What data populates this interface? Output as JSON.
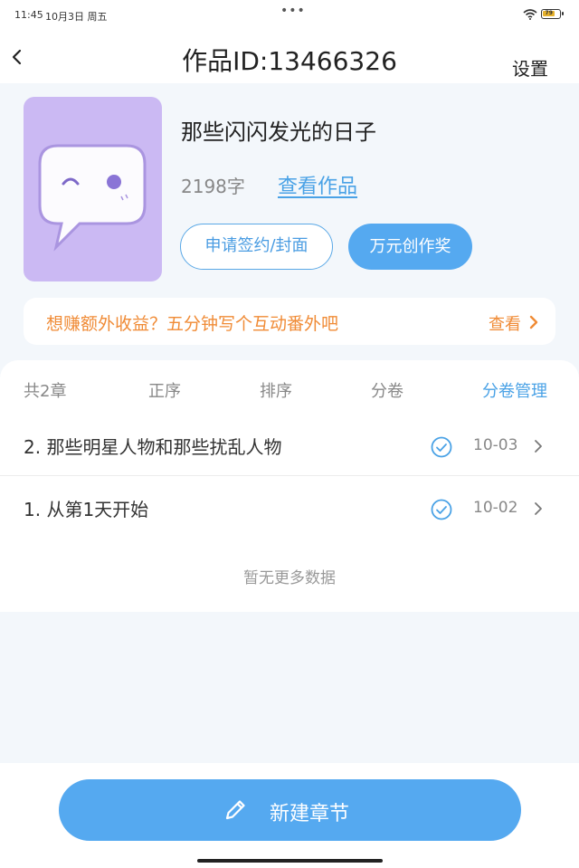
{
  "status_bar": {
    "time": "11:45",
    "date": "10月3日 周五",
    "dots": "•••",
    "battery": "79",
    "battery_level_pct": 79
  },
  "header": {
    "title": "作品ID:13466326",
    "settings_label": "设置"
  },
  "work": {
    "title": "那些闪闪发光的日子",
    "word_count": "2198字",
    "view_link": "查看作品",
    "apply_button": "申请签约/封面",
    "award_button": "万元创作奖"
  },
  "promo": {
    "text": "想赚额外收益？五分钟写个互动番外吧",
    "view_label": "查看"
  },
  "chapters": {
    "tabs": [
      "共2章",
      "正序",
      "排序",
      "分卷",
      "分卷管理"
    ],
    "items": [
      {
        "title": "2. 那些明星人物和那些扰乱人物",
        "date": "10-03"
      },
      {
        "title": "1. 从第1天开始",
        "date": "10-02"
      }
    ],
    "no_more": "暂无更多数据"
  },
  "bottom": {
    "new_chapter_label": "新建章节"
  },
  "colors": {
    "accent": "#55a9f0",
    "link": "#4aa2e6",
    "promo": "#f08b36",
    "cover_bg": "#cbb9f3",
    "page_bg": "#f3f7fb"
  }
}
